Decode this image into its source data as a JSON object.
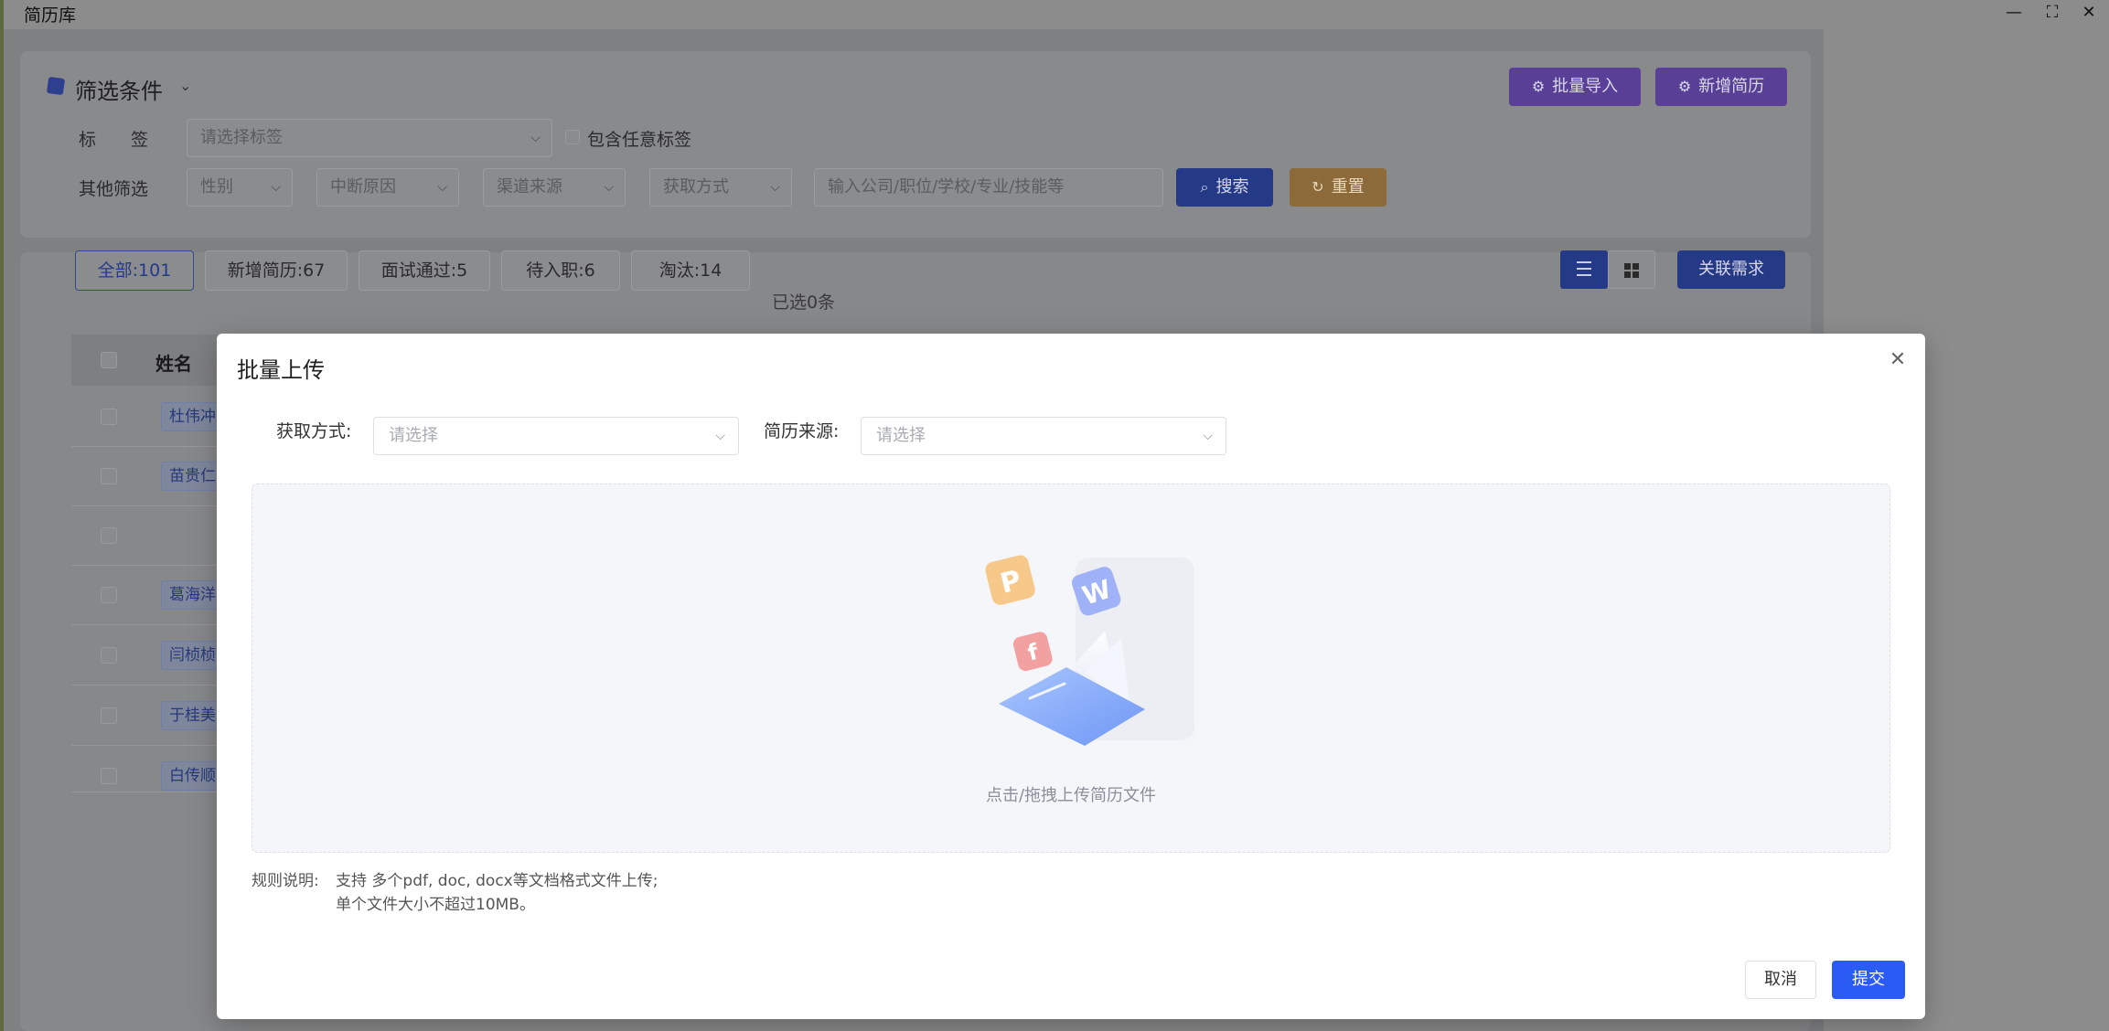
{
  "window": {
    "title": "简历库",
    "minimize_glyph": "—",
    "maximize_glyph": "⛶",
    "close_glyph": "✕"
  },
  "filters": {
    "title": "筛选条件",
    "tag_label": "标　　签",
    "tag_placeholder": "请选择标签",
    "include_any_tag": "包含任意标签",
    "other_label": "其他筛选",
    "gender_placeholder": "性别",
    "interrupt_placeholder": "中断原因",
    "channel_placeholder": "渠道来源",
    "acquire_placeholder": "获取方式",
    "keyword_placeholder": "输入公司/职位/学校/专业/技能等",
    "search_label": "搜索",
    "reset_label": "重置",
    "batch_import_label": "批量导入",
    "add_resume_label": "新增简历"
  },
  "tabs": [
    {
      "label": "全部:101",
      "active": true
    },
    {
      "label": "新增简历:67",
      "active": false
    },
    {
      "label": "面试通过:5",
      "active": false
    },
    {
      "label": "待入职:6",
      "active": false
    },
    {
      "label": "淘汰:14",
      "active": false
    }
  ],
  "selected_count": "已选0条",
  "link_demand_label": "关联需求",
  "table": {
    "name_header": "姓名",
    "rows": [
      "杜伟冲",
      "苗贵仁",
      "",
      "葛海洋",
      "闫桢桢",
      "于桂美",
      "白传顺"
    ]
  },
  "modal": {
    "title": "批量上传",
    "acquire_label": "获取方式:",
    "acquire_placeholder": "请选择",
    "source_label": "简历来源:",
    "source_placeholder": "请选择",
    "upload_hint": "点击/拖拽上传简历文件",
    "rules_label": "规则说明:",
    "rules_line1": "支持 多个pdf, doc, docx等文档格式文件上传;",
    "rules_line2": "单个文件大小不超过10MB。",
    "cancel_label": "取消",
    "submit_label": "提交"
  },
  "colors": {
    "primary": "#2a5bf5",
    "import_button": "#7a3fd6",
    "reset_button": "#d9922a"
  }
}
